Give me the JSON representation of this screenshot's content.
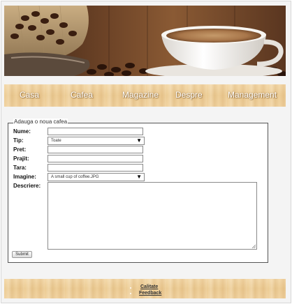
{
  "nav": {
    "items": [
      {
        "label": "Casa"
      },
      {
        "label": "Cafea"
      },
      {
        "label": "Magazine"
      },
      {
        "label": "Despre"
      },
      {
        "label": "Management"
      }
    ]
  },
  "form": {
    "legend": "Adauga o noua cafea",
    "fields": {
      "nume": {
        "label": "Nume:",
        "value": ""
      },
      "tip": {
        "label": "Tip:",
        "selected": "Toate"
      },
      "pret": {
        "label": "Pret:",
        "value": ""
      },
      "prajit": {
        "label": "Prajit:",
        "value": ""
      },
      "tara": {
        "label": "Tara:",
        "value": ""
      },
      "imagine": {
        "label": "Imagine:",
        "selected": "A small cup of coffee.JPG"
      },
      "descriere": {
        "label": "Descriere:",
        "value": ""
      }
    },
    "submit_label": "Submit"
  },
  "footer": {
    "links": [
      {
        "label": "Calitate"
      },
      {
        "label": "Feedback"
      }
    ]
  },
  "colors": {
    "wood_light": "#f3d7a6",
    "wood_dark": "#eccb92",
    "banner_dark": "#5a3a22",
    "cup": "#f4f2ee"
  },
  "icons": {
    "select_arrow": "triangle-down",
    "resize_grip": "diagonal-lines"
  }
}
